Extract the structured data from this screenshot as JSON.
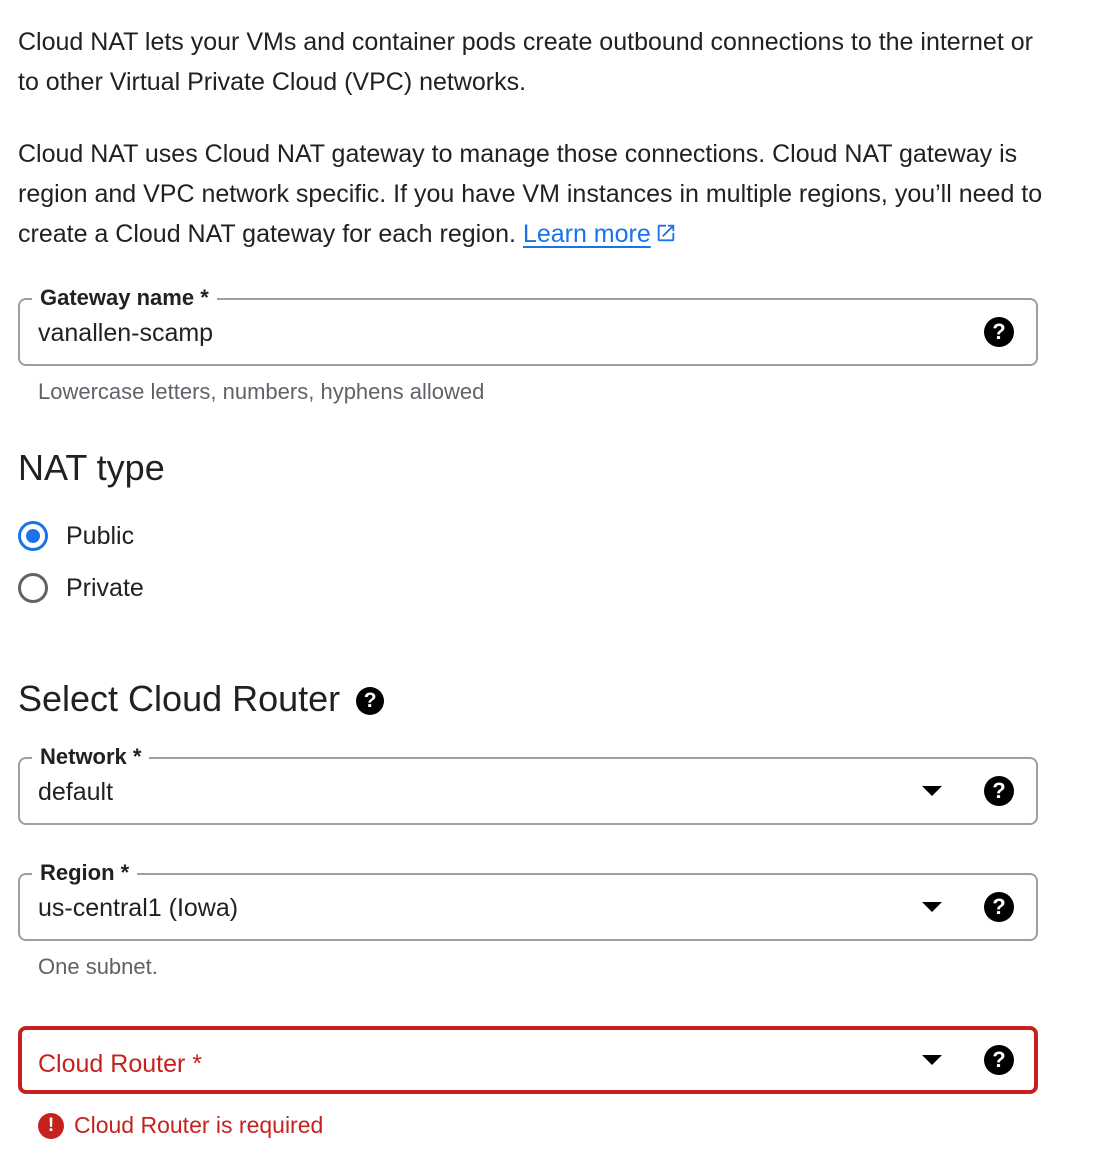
{
  "intro": {
    "paragraph1": "Cloud NAT lets your VMs and container pods create outbound connections to the internet or to other Virtual Private Cloud (VPC) networks.",
    "paragraph2": "Cloud NAT uses Cloud NAT gateway to manage those connections. Cloud NAT gateway is region and VPC network specific. If you have VM instances in multiple regions, you’ll need to create a Cloud NAT gateway for each region.",
    "learn_more": "Learn more"
  },
  "gateway_name": {
    "label": "Gateway name *",
    "value": "vanallen-scamp",
    "hint": "Lowercase letters, numbers, hyphens allowed"
  },
  "nat_type": {
    "heading": "NAT type",
    "options": [
      {
        "label": "Public",
        "selected": true
      },
      {
        "label": "Private",
        "selected": false
      }
    ]
  },
  "cloud_router_section": {
    "heading": "Select Cloud Router"
  },
  "network": {
    "label": "Network *",
    "value": "default"
  },
  "region": {
    "label": "Region *",
    "value": "us-central1 (Iowa)",
    "hint": "One subnet."
  },
  "cloud_router": {
    "placeholder": "Cloud Router *",
    "error": "Cloud Router is required"
  },
  "icons": {
    "help": "?",
    "error": "!"
  },
  "colors": {
    "link": "#1a73e8",
    "radio_selected": "#1a73e8",
    "error": "#c5221f"
  }
}
